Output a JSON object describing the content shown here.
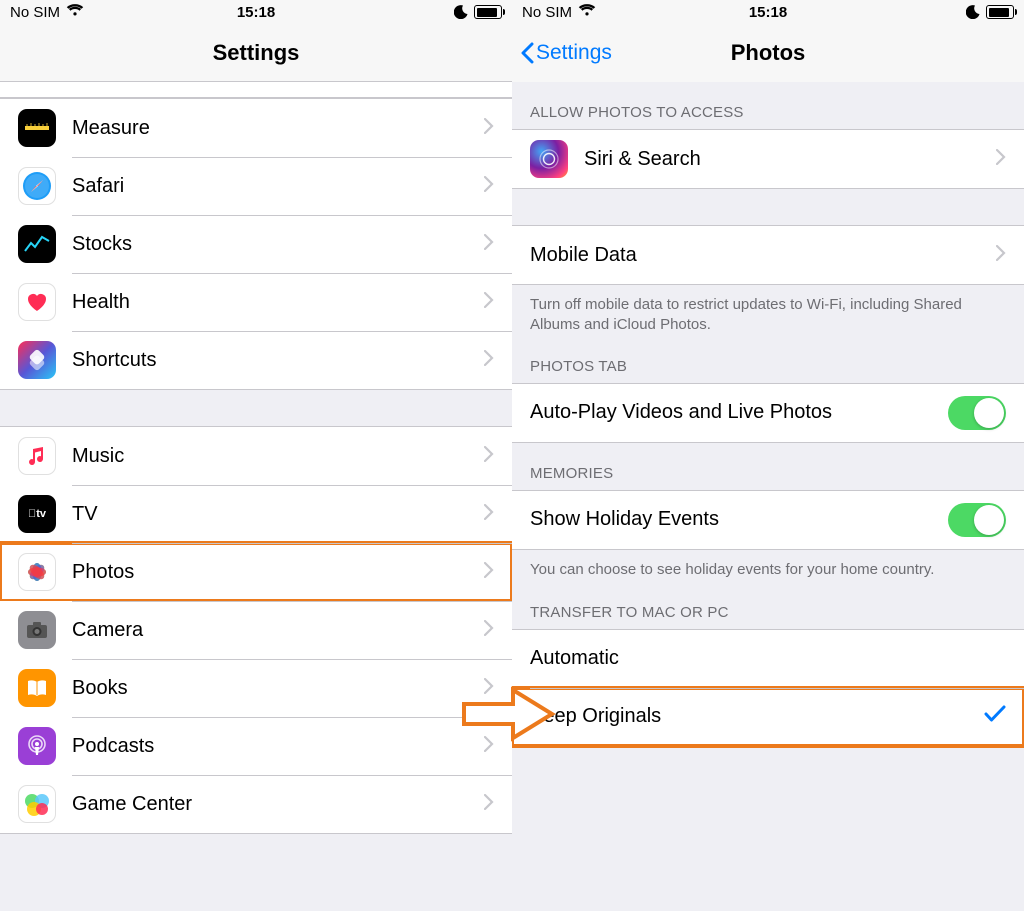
{
  "status": {
    "carrier": "No SIM",
    "time": "15:18"
  },
  "left": {
    "title": "Settings",
    "rows": [
      {
        "key": "measure",
        "label": "Measure"
      },
      {
        "key": "safari",
        "label": "Safari"
      },
      {
        "key": "stocks",
        "label": "Stocks"
      },
      {
        "key": "health",
        "label": "Health"
      },
      {
        "key": "shortcuts",
        "label": "Shortcuts"
      },
      {
        "key": "music",
        "label": "Music"
      },
      {
        "key": "tv",
        "label": "TV"
      },
      {
        "key": "photos",
        "label": "Photos"
      },
      {
        "key": "camera",
        "label": "Camera"
      },
      {
        "key": "books",
        "label": "Books"
      },
      {
        "key": "podcasts",
        "label": "Podcasts"
      },
      {
        "key": "gamecenter",
        "label": "Game Center"
      }
    ]
  },
  "right": {
    "back": "Settings",
    "title": "Photos",
    "sections": {
      "access_header": "ALLOW PHOTOS TO ACCESS",
      "siri": "Siri & Search",
      "mobiledata": "Mobile Data",
      "mobiledata_footer": "Turn off mobile data to restrict updates to Wi-Fi, including Shared Albums and iCloud Photos.",
      "photostab_header": "PHOTOS TAB",
      "autoplay": "Auto-Play Videos and Live Photos",
      "memories_header": "MEMORIES",
      "holiday": "Show Holiday Events",
      "holiday_footer": "You can choose to see holiday events for your home country.",
      "transfer_header": "TRANSFER TO MAC OR PC",
      "automatic": "Automatic",
      "keep_originals": "Keep Originals"
    }
  },
  "colors": {
    "highlight": "#ec7a1c",
    "link": "#007aff",
    "toggle_on": "#4cd964"
  }
}
